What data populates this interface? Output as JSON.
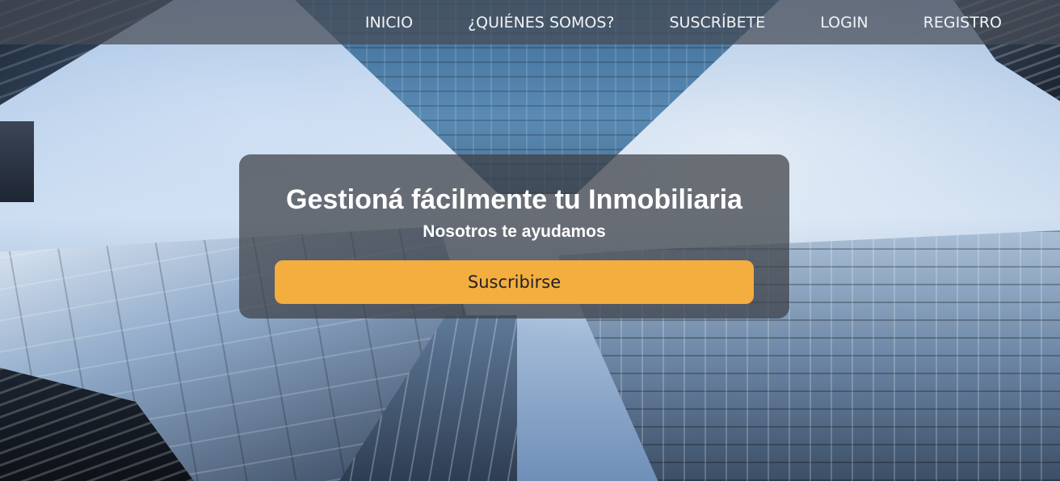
{
  "nav": {
    "items": [
      {
        "label": "INICIO"
      },
      {
        "label": "¿QUIÉNES SOMOS?"
      },
      {
        "label": "SUSCRÍBETE"
      },
      {
        "label": "LOGIN"
      },
      {
        "label": "REGISTRO"
      }
    ]
  },
  "hero": {
    "title": "Gestioná fácilmente tu Inmobiliaria",
    "subtitle": "Nosotros te ayudamos",
    "cta_label": "Suscribirse"
  },
  "colors": {
    "cta_background": "#f4ad3f",
    "navbar_background": "rgba(70,75,85,0.72)",
    "card_background": "rgba(60,62,68,0.72)",
    "text_light": "#ffffff"
  }
}
